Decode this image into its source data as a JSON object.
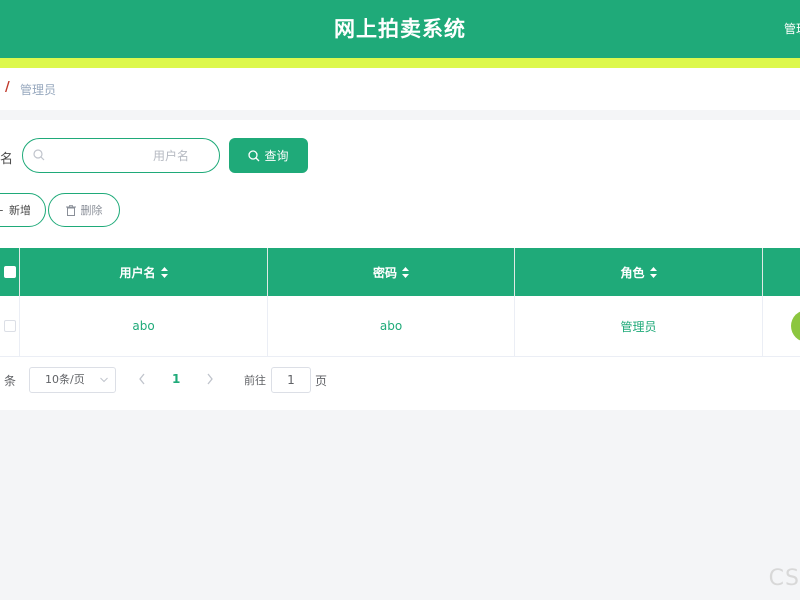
{
  "header": {
    "title": "网上拍卖系统",
    "user_menu": "管理员"
  },
  "breadcrumb": {
    "separator": "/",
    "current": "管理员"
  },
  "search": {
    "label": "名",
    "placeholder": "用户名",
    "value": "",
    "query_button": "查询"
  },
  "toolbar": {
    "add_label": "新增",
    "delete_label": "删除"
  },
  "table": {
    "columns": [
      "用户名",
      "密码",
      "角色"
    ],
    "rows": [
      {
        "username": "abo",
        "password": "abo",
        "role": "管理员"
      }
    ]
  },
  "pagination": {
    "total_suffix": "条",
    "page_size": "10条/页",
    "current_page": "1",
    "goto_label": "前往",
    "goto_value": "1",
    "page_unit": "页"
  },
  "watermark": "CS",
  "colors": {
    "accent": "#1faa79",
    "stripe": "#ddf84c",
    "action": "#8cc63f"
  }
}
